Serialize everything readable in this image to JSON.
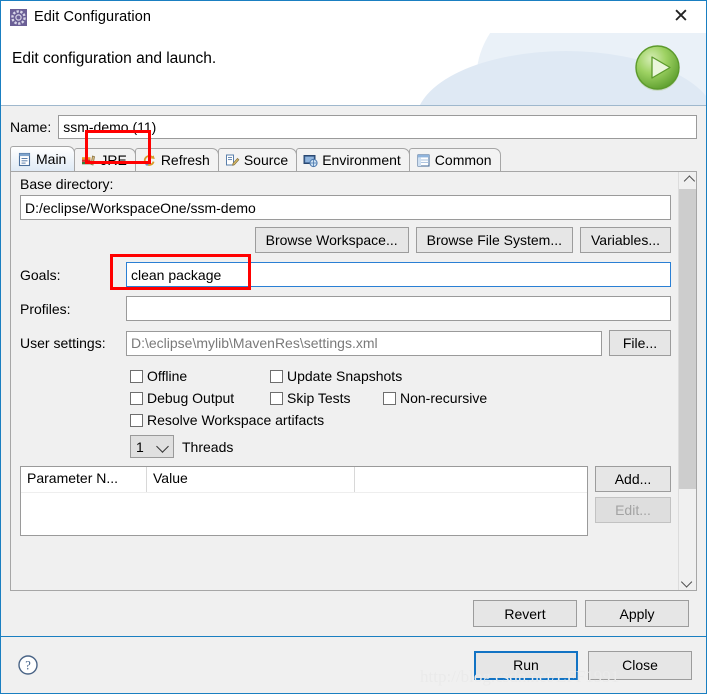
{
  "window": {
    "title": "Edit Configuration",
    "icon": "gear-icon",
    "close_label": "✕"
  },
  "header": {
    "title": "Edit configuration and launch.",
    "badge_icon": "run-play-icon"
  },
  "name_field": {
    "label": "Name:",
    "value": "ssm-demo (11)"
  },
  "tabs": [
    {
      "label": "Main",
      "icon": "document-icon",
      "selected": true
    },
    {
      "label": "JRE",
      "icon": "jre-books-icon",
      "selected": false
    },
    {
      "label": "Refresh",
      "icon": "refresh-icon",
      "selected": false
    },
    {
      "label": "Source",
      "icon": "source-icon",
      "selected": false
    },
    {
      "label": "Environment",
      "icon": "environment-icon",
      "selected": false
    },
    {
      "label": "Common",
      "icon": "common-icon",
      "selected": false
    }
  ],
  "main_tab": {
    "base_directory": {
      "label": "Base directory:",
      "value": "D:/eclipse/WorkspaceOne/ssm-demo"
    },
    "browse_buttons": [
      {
        "label": "Browse Workspace..."
      },
      {
        "label": "Browse File System..."
      },
      {
        "label": "Variables..."
      }
    ],
    "goals": {
      "label": "Goals:",
      "value": "clean package"
    },
    "profiles": {
      "label": "Profiles:",
      "value": ""
    },
    "user_settings": {
      "label": "User settings:",
      "value": "D:\\eclipse\\mylib\\MavenRes\\settings.xml",
      "button_label": "File..."
    },
    "checkboxes": [
      {
        "label": "Offline",
        "checked": false
      },
      {
        "label": "Update Snapshots",
        "checked": false
      },
      {
        "label": "Debug Output",
        "checked": false
      },
      {
        "label": "Skip Tests",
        "checked": false
      },
      {
        "label": "Non-recursive",
        "checked": false
      },
      {
        "label": "Resolve Workspace artifacts",
        "checked": false
      }
    ],
    "threads": {
      "value": "1",
      "label": "Threads"
    },
    "parameter_table": {
      "columns": [
        "Parameter N...",
        "Value",
        ""
      ],
      "rows": [],
      "add_label": "Add...",
      "edit_label": "Edit...",
      "edit_disabled": true
    }
  },
  "dialog_buttons": {
    "revert": "Revert",
    "apply": "Apply",
    "run": "Run",
    "close": "Close",
    "help_icon": "help-question-icon"
  },
  "watermark": "http://blog.csdn.net/LFF1991",
  "colors": {
    "accent_blue": "#1a7fc1",
    "annotation_red": "#ff0000",
    "focus_blue": "#2a7fd4",
    "run_green": "#7cc24a"
  }
}
